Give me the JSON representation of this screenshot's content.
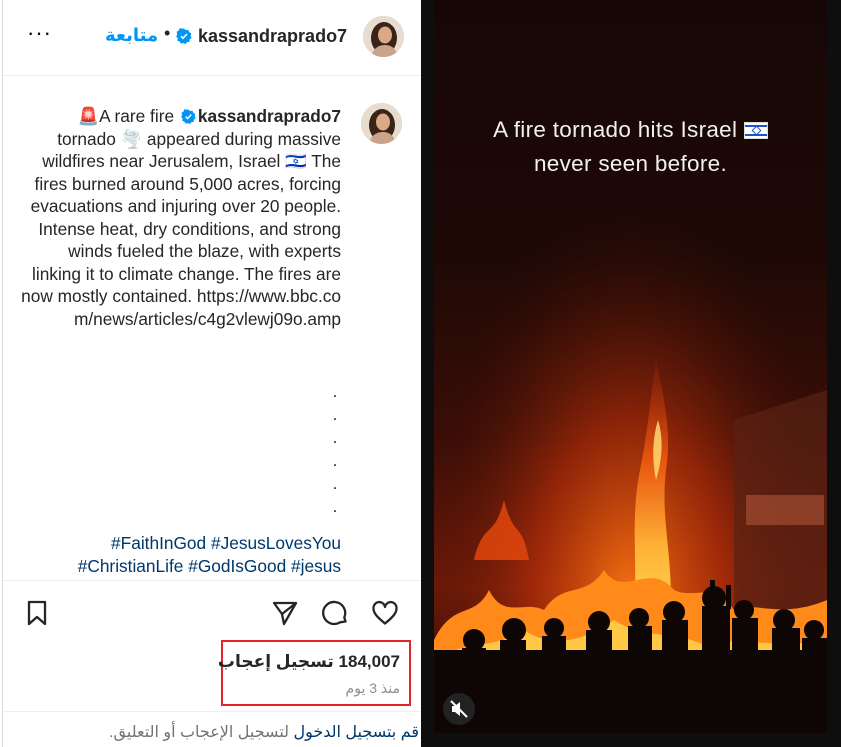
{
  "header": {
    "username": "kassandraprado7",
    "follow_label": "متابعة",
    "separator": "•",
    "more_label": "···"
  },
  "caption": {
    "username": "kassandraprado7",
    "prefix_emoji": "🚨",
    "lead": "A rare fire",
    "body": "tornado 🌪️ appeared during massive wildfires near Jerusalem, Israel 🇮🇱 The fires burned around 5,000 acres, forcing evacuations and injuring over 20 people. Intense heat, dry conditions, and strong winds fueled the blaze, with experts linking it to climate change. The fires are now mostly contained.",
    "url": "https://www.bbc.com/news/articles/c4g2vlewj09o.amp",
    "dots": ".\n.\n.\n.\n.\n.",
    "hashtags": [
      "#FaithInGod",
      "#JesusLovesYou",
      "#ChristianLife",
      "#GodIsGood",
      "#jesus"
    ]
  },
  "likes": {
    "text": "184,007 تسجيل إعجاب",
    "time": "منذ 3 يوم"
  },
  "login": {
    "link": "قم بتسجيل الدخول",
    "rest": " لتسجيل الإعجاب أو التعليق."
  },
  "video": {
    "overlay_line1": "A fire tornado hits Israel",
    "overlay_line2": "never seen before."
  },
  "icons": {
    "more": "more-options-icon",
    "verified": "verified-badge-icon",
    "save": "bookmark-icon",
    "share": "send-icon",
    "comment": "comment-icon",
    "like": "heart-icon",
    "mute": "muted-speaker-icon"
  },
  "colors": {
    "accent": "#0095f6",
    "hashtag": "#00376b",
    "highlight_box": "#e0262b"
  }
}
